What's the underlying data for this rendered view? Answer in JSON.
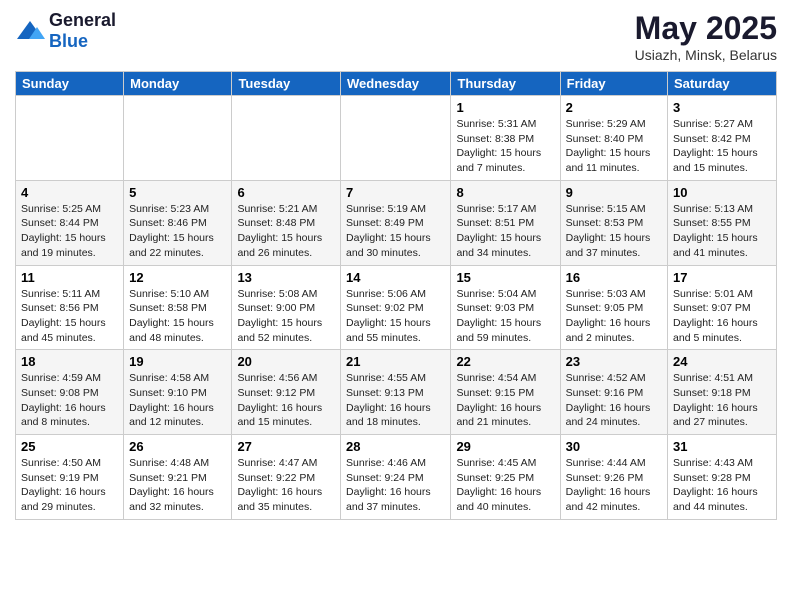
{
  "header": {
    "logo_general": "General",
    "logo_blue": "Blue",
    "title": "May 2025",
    "subtitle": "Usiazh, Minsk, Belarus"
  },
  "days_of_week": [
    "Sunday",
    "Monday",
    "Tuesday",
    "Wednesday",
    "Thursday",
    "Friday",
    "Saturday"
  ],
  "weeks": [
    [
      {
        "day": "",
        "info": ""
      },
      {
        "day": "",
        "info": ""
      },
      {
        "day": "",
        "info": ""
      },
      {
        "day": "",
        "info": ""
      },
      {
        "day": "1",
        "info": "Sunrise: 5:31 AM\nSunset: 8:38 PM\nDaylight: 15 hours\nand 7 minutes."
      },
      {
        "day": "2",
        "info": "Sunrise: 5:29 AM\nSunset: 8:40 PM\nDaylight: 15 hours\nand 11 minutes."
      },
      {
        "day": "3",
        "info": "Sunrise: 5:27 AM\nSunset: 8:42 PM\nDaylight: 15 hours\nand 15 minutes."
      }
    ],
    [
      {
        "day": "4",
        "info": "Sunrise: 5:25 AM\nSunset: 8:44 PM\nDaylight: 15 hours\nand 19 minutes."
      },
      {
        "day": "5",
        "info": "Sunrise: 5:23 AM\nSunset: 8:46 PM\nDaylight: 15 hours\nand 22 minutes."
      },
      {
        "day": "6",
        "info": "Sunrise: 5:21 AM\nSunset: 8:48 PM\nDaylight: 15 hours\nand 26 minutes."
      },
      {
        "day": "7",
        "info": "Sunrise: 5:19 AM\nSunset: 8:49 PM\nDaylight: 15 hours\nand 30 minutes."
      },
      {
        "day": "8",
        "info": "Sunrise: 5:17 AM\nSunset: 8:51 PM\nDaylight: 15 hours\nand 34 minutes."
      },
      {
        "day": "9",
        "info": "Sunrise: 5:15 AM\nSunset: 8:53 PM\nDaylight: 15 hours\nand 37 minutes."
      },
      {
        "day": "10",
        "info": "Sunrise: 5:13 AM\nSunset: 8:55 PM\nDaylight: 15 hours\nand 41 minutes."
      }
    ],
    [
      {
        "day": "11",
        "info": "Sunrise: 5:11 AM\nSunset: 8:56 PM\nDaylight: 15 hours\nand 45 minutes."
      },
      {
        "day": "12",
        "info": "Sunrise: 5:10 AM\nSunset: 8:58 PM\nDaylight: 15 hours\nand 48 minutes."
      },
      {
        "day": "13",
        "info": "Sunrise: 5:08 AM\nSunset: 9:00 PM\nDaylight: 15 hours\nand 52 minutes."
      },
      {
        "day": "14",
        "info": "Sunrise: 5:06 AM\nSunset: 9:02 PM\nDaylight: 15 hours\nand 55 minutes."
      },
      {
        "day": "15",
        "info": "Sunrise: 5:04 AM\nSunset: 9:03 PM\nDaylight: 15 hours\nand 59 minutes."
      },
      {
        "day": "16",
        "info": "Sunrise: 5:03 AM\nSunset: 9:05 PM\nDaylight: 16 hours\nand 2 minutes."
      },
      {
        "day": "17",
        "info": "Sunrise: 5:01 AM\nSunset: 9:07 PM\nDaylight: 16 hours\nand 5 minutes."
      }
    ],
    [
      {
        "day": "18",
        "info": "Sunrise: 4:59 AM\nSunset: 9:08 PM\nDaylight: 16 hours\nand 8 minutes."
      },
      {
        "day": "19",
        "info": "Sunrise: 4:58 AM\nSunset: 9:10 PM\nDaylight: 16 hours\nand 12 minutes."
      },
      {
        "day": "20",
        "info": "Sunrise: 4:56 AM\nSunset: 9:12 PM\nDaylight: 16 hours\nand 15 minutes."
      },
      {
        "day": "21",
        "info": "Sunrise: 4:55 AM\nSunset: 9:13 PM\nDaylight: 16 hours\nand 18 minutes."
      },
      {
        "day": "22",
        "info": "Sunrise: 4:54 AM\nSunset: 9:15 PM\nDaylight: 16 hours\nand 21 minutes."
      },
      {
        "day": "23",
        "info": "Sunrise: 4:52 AM\nSunset: 9:16 PM\nDaylight: 16 hours\nand 24 minutes."
      },
      {
        "day": "24",
        "info": "Sunrise: 4:51 AM\nSunset: 9:18 PM\nDaylight: 16 hours\nand 27 minutes."
      }
    ],
    [
      {
        "day": "25",
        "info": "Sunrise: 4:50 AM\nSunset: 9:19 PM\nDaylight: 16 hours\nand 29 minutes."
      },
      {
        "day": "26",
        "info": "Sunrise: 4:48 AM\nSunset: 9:21 PM\nDaylight: 16 hours\nand 32 minutes."
      },
      {
        "day": "27",
        "info": "Sunrise: 4:47 AM\nSunset: 9:22 PM\nDaylight: 16 hours\nand 35 minutes."
      },
      {
        "day": "28",
        "info": "Sunrise: 4:46 AM\nSunset: 9:24 PM\nDaylight: 16 hours\nand 37 minutes."
      },
      {
        "day": "29",
        "info": "Sunrise: 4:45 AM\nSunset: 9:25 PM\nDaylight: 16 hours\nand 40 minutes."
      },
      {
        "day": "30",
        "info": "Sunrise: 4:44 AM\nSunset: 9:26 PM\nDaylight: 16 hours\nand 42 minutes."
      },
      {
        "day": "31",
        "info": "Sunrise: 4:43 AM\nSunset: 9:28 PM\nDaylight: 16 hours\nand 44 minutes."
      }
    ]
  ]
}
